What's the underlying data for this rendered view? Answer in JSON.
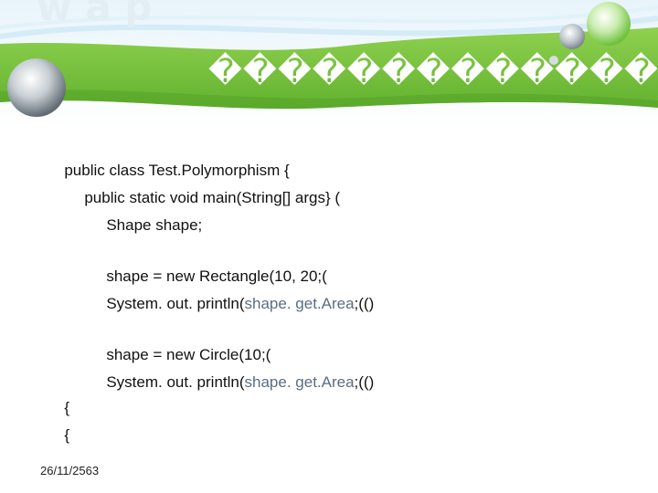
{
  "slide": {
    "title": "��������������",
    "code_lines": [
      {
        "pre": "public class Test.Polymorphism {",
        "hl": "",
        "post": ""
      },
      {
        "pre": "public static void main(String[] args} (",
        "hl": "",
        "post": ""
      },
      {
        "pre": "Shape shape;",
        "hl": "",
        "post": ""
      },
      {
        "pre": "shape = new Rectangle(10, 20;(",
        "hl": "",
        "post": ""
      },
      {
        "pre": "System. out. println(",
        "hl": "shape. get.Area",
        "post": ";(()"
      },
      {
        "pre": "shape = new Circle(10;(",
        "hl": "",
        "post": ""
      },
      {
        "pre": "System. out. println(",
        "hl": "shape. get.Area",
        "post": ";(()"
      },
      {
        "pre": "{",
        "hl": "",
        "post": ""
      },
      {
        "pre": "{",
        "hl": "",
        "post": ""
      }
    ],
    "date": "26/11/2563"
  },
  "colors": {
    "banner_green": "#7dc242",
    "title_text": "#ffffff",
    "highlight_text": "#5a6d85"
  }
}
